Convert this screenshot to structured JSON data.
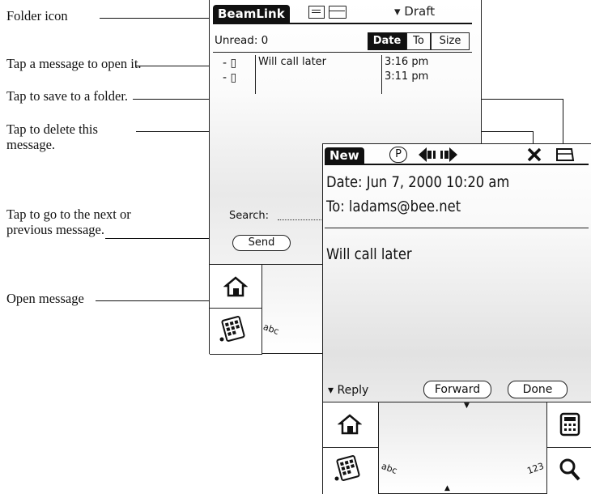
{
  "callouts": {
    "folder_icon": "Folder icon",
    "open_it": "Tap a message to open it.",
    "save_folder": "Tap to save to a folder.",
    "delete_1": "Tap to delete this",
    "delete_2": "message.",
    "next_prev_1": "Tap to go to the next or",
    "next_prev_2": "previous message.",
    "open_message": "Open message"
  },
  "list_screen": {
    "app_title": "BeamLink",
    "folder_menu": "▾ Draft",
    "unread": "Unread: 0",
    "sort_tabs": [
      "Date",
      "To",
      "Size"
    ],
    "messages": [
      {
        "subject": "Will call later",
        "time": "3:16 pm"
      },
      {
        "subject": "",
        "time": "3:11 pm"
      }
    ],
    "search_label": "Search:",
    "send_button": "Send",
    "graffiti_abc": "abc"
  },
  "message_screen": {
    "title": "New",
    "priority": "P",
    "date": "Date: Jun 7, 2000  10:20 am",
    "to": "To: ladams@bee.net",
    "body": "Will call later",
    "reply_menu": "▾ Reply",
    "forward_button": "Forward",
    "done_button": "Done",
    "graffiti_abc": "abc",
    "graffiti_123": "123"
  }
}
